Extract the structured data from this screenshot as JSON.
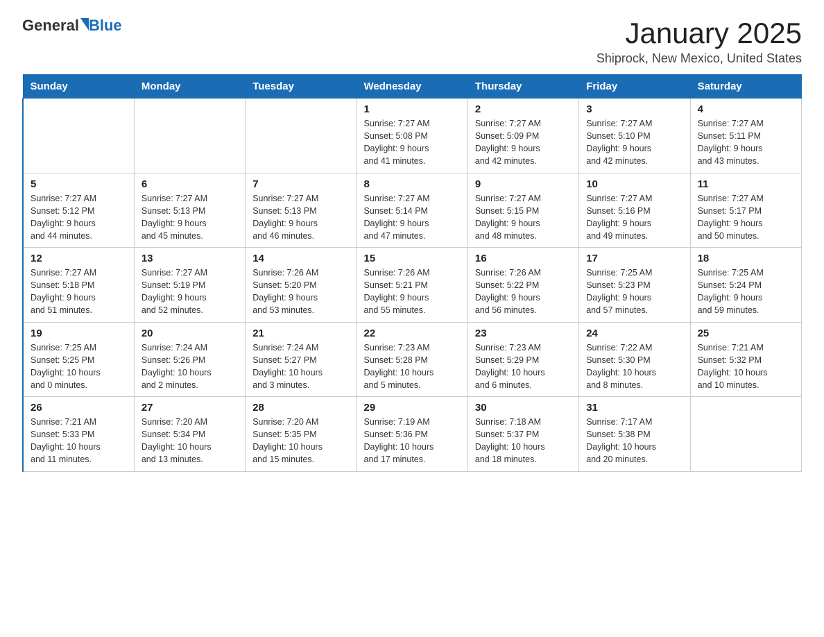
{
  "header": {
    "logo_general": "General",
    "logo_blue": "Blue",
    "title": "January 2025",
    "subtitle": "Shiprock, New Mexico, United States"
  },
  "days_of_week": [
    "Sunday",
    "Monday",
    "Tuesday",
    "Wednesday",
    "Thursday",
    "Friday",
    "Saturday"
  ],
  "weeks": [
    [
      {
        "day": "",
        "info": ""
      },
      {
        "day": "",
        "info": ""
      },
      {
        "day": "",
        "info": ""
      },
      {
        "day": "1",
        "info": "Sunrise: 7:27 AM\nSunset: 5:08 PM\nDaylight: 9 hours\nand 41 minutes."
      },
      {
        "day": "2",
        "info": "Sunrise: 7:27 AM\nSunset: 5:09 PM\nDaylight: 9 hours\nand 42 minutes."
      },
      {
        "day": "3",
        "info": "Sunrise: 7:27 AM\nSunset: 5:10 PM\nDaylight: 9 hours\nand 42 minutes."
      },
      {
        "day": "4",
        "info": "Sunrise: 7:27 AM\nSunset: 5:11 PM\nDaylight: 9 hours\nand 43 minutes."
      }
    ],
    [
      {
        "day": "5",
        "info": "Sunrise: 7:27 AM\nSunset: 5:12 PM\nDaylight: 9 hours\nand 44 minutes."
      },
      {
        "day": "6",
        "info": "Sunrise: 7:27 AM\nSunset: 5:13 PM\nDaylight: 9 hours\nand 45 minutes."
      },
      {
        "day": "7",
        "info": "Sunrise: 7:27 AM\nSunset: 5:13 PM\nDaylight: 9 hours\nand 46 minutes."
      },
      {
        "day": "8",
        "info": "Sunrise: 7:27 AM\nSunset: 5:14 PM\nDaylight: 9 hours\nand 47 minutes."
      },
      {
        "day": "9",
        "info": "Sunrise: 7:27 AM\nSunset: 5:15 PM\nDaylight: 9 hours\nand 48 minutes."
      },
      {
        "day": "10",
        "info": "Sunrise: 7:27 AM\nSunset: 5:16 PM\nDaylight: 9 hours\nand 49 minutes."
      },
      {
        "day": "11",
        "info": "Sunrise: 7:27 AM\nSunset: 5:17 PM\nDaylight: 9 hours\nand 50 minutes."
      }
    ],
    [
      {
        "day": "12",
        "info": "Sunrise: 7:27 AM\nSunset: 5:18 PM\nDaylight: 9 hours\nand 51 minutes."
      },
      {
        "day": "13",
        "info": "Sunrise: 7:27 AM\nSunset: 5:19 PM\nDaylight: 9 hours\nand 52 minutes."
      },
      {
        "day": "14",
        "info": "Sunrise: 7:26 AM\nSunset: 5:20 PM\nDaylight: 9 hours\nand 53 minutes."
      },
      {
        "day": "15",
        "info": "Sunrise: 7:26 AM\nSunset: 5:21 PM\nDaylight: 9 hours\nand 55 minutes."
      },
      {
        "day": "16",
        "info": "Sunrise: 7:26 AM\nSunset: 5:22 PM\nDaylight: 9 hours\nand 56 minutes."
      },
      {
        "day": "17",
        "info": "Sunrise: 7:25 AM\nSunset: 5:23 PM\nDaylight: 9 hours\nand 57 minutes."
      },
      {
        "day": "18",
        "info": "Sunrise: 7:25 AM\nSunset: 5:24 PM\nDaylight: 9 hours\nand 59 minutes."
      }
    ],
    [
      {
        "day": "19",
        "info": "Sunrise: 7:25 AM\nSunset: 5:25 PM\nDaylight: 10 hours\nand 0 minutes."
      },
      {
        "day": "20",
        "info": "Sunrise: 7:24 AM\nSunset: 5:26 PM\nDaylight: 10 hours\nand 2 minutes."
      },
      {
        "day": "21",
        "info": "Sunrise: 7:24 AM\nSunset: 5:27 PM\nDaylight: 10 hours\nand 3 minutes."
      },
      {
        "day": "22",
        "info": "Sunrise: 7:23 AM\nSunset: 5:28 PM\nDaylight: 10 hours\nand 5 minutes."
      },
      {
        "day": "23",
        "info": "Sunrise: 7:23 AM\nSunset: 5:29 PM\nDaylight: 10 hours\nand 6 minutes."
      },
      {
        "day": "24",
        "info": "Sunrise: 7:22 AM\nSunset: 5:30 PM\nDaylight: 10 hours\nand 8 minutes."
      },
      {
        "day": "25",
        "info": "Sunrise: 7:21 AM\nSunset: 5:32 PM\nDaylight: 10 hours\nand 10 minutes."
      }
    ],
    [
      {
        "day": "26",
        "info": "Sunrise: 7:21 AM\nSunset: 5:33 PM\nDaylight: 10 hours\nand 11 minutes."
      },
      {
        "day": "27",
        "info": "Sunrise: 7:20 AM\nSunset: 5:34 PM\nDaylight: 10 hours\nand 13 minutes."
      },
      {
        "day": "28",
        "info": "Sunrise: 7:20 AM\nSunset: 5:35 PM\nDaylight: 10 hours\nand 15 minutes."
      },
      {
        "day": "29",
        "info": "Sunrise: 7:19 AM\nSunset: 5:36 PM\nDaylight: 10 hours\nand 17 minutes."
      },
      {
        "day": "30",
        "info": "Sunrise: 7:18 AM\nSunset: 5:37 PM\nDaylight: 10 hours\nand 18 minutes."
      },
      {
        "day": "31",
        "info": "Sunrise: 7:17 AM\nSunset: 5:38 PM\nDaylight: 10 hours\nand 20 minutes."
      },
      {
        "day": "",
        "info": ""
      }
    ]
  ]
}
